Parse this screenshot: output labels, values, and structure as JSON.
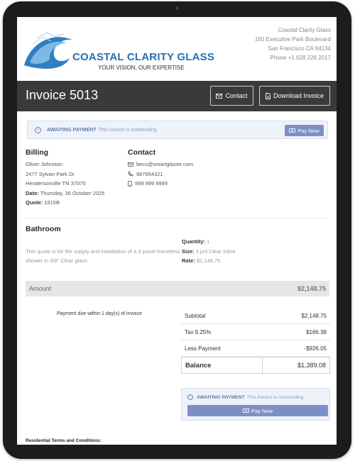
{
  "company": {
    "logo_title": "COASTAL CLARITY GLASS",
    "logo_tagline": "YOUR VISION, OUR EXPERTISE",
    "name": "Coastal Clarity Glass",
    "address_line1": "150 Executive Park Boulevard",
    "address_line2": "San Francisco CA 94134",
    "phone": "Phone +1 628 226 2017"
  },
  "invoice": {
    "title": "Invoice 5013",
    "contact_button": "Contact",
    "download_button": "Download Invoice"
  },
  "alert": {
    "status": "AWAITING PAYMENT",
    "message": "This invoice is outstanding",
    "pay_button": "Pay Now"
  },
  "billing": {
    "heading": "Billing",
    "name": "Oliver Johnston",
    "street": "2477 Sylvan Park Dr",
    "city": "Hendersonville TN 37075",
    "date_label": "Date:",
    "date_value": "Thursday, 30 October 2025",
    "quote_label": "Quote:",
    "quote_value": "1915B"
  },
  "contact": {
    "heading": "Contact",
    "email": "becs@smartglazier.com",
    "phone": "987654321",
    "mobile": "999 999 9999"
  },
  "item": {
    "room": "Bathroom",
    "description": "This quote is for the supply and installation of a 3 panel frameless shower in 3/8\" Clear glass.",
    "quantity_label": "Quantity:",
    "quantity_value": "1",
    "size_label": "Size:",
    "size_value": "3 pnl Clear Inline",
    "rate_label": "Rate:",
    "rate_value": "$2,148.75"
  },
  "amount": {
    "label": "Amount",
    "value": "$2,148.75"
  },
  "payment_due": "Payment due within 1 day(s) of invoice",
  "totals": {
    "subtotal_label": "Subtotal",
    "subtotal_value": "$2,148.75",
    "tax_label": "Tax 9.25%",
    "tax_value": "$166.38",
    "less_payment_label": "Less Payment",
    "less_payment_value": "-$926.05",
    "balance_label": "Balance",
    "balance_value": "$1,389.08"
  },
  "terms_heading": "Residential Terms and Conditions:",
  "colors": {
    "header_bar": "#3a3a3d",
    "accent_button": "#7d8fc6",
    "alert_bg": "#eef3fa",
    "logo_blue": "#2a6fb0"
  }
}
